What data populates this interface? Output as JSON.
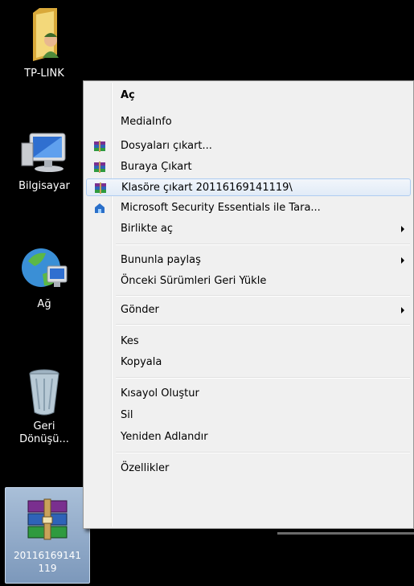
{
  "desktop": {
    "icons": [
      {
        "label": "TP-LINK"
      },
      {
        "label": "Bilgisayar"
      },
      {
        "label": "Ağ"
      },
      {
        "label": "Geri Dönüşü..."
      },
      {
        "label": "20116169141 119"
      }
    ]
  },
  "context_menu": {
    "items": [
      {
        "label": "Aç"
      },
      {
        "label": "MediaInfo"
      },
      {
        "label": "Dosyaları çıkart..."
      },
      {
        "label": "Buraya Çıkart"
      },
      {
        "label": "Klasöre çıkart 20116169141119\\"
      },
      {
        "label": "Microsoft Security Essentials ile Tara..."
      },
      {
        "label": "Birlikte aç"
      },
      {
        "label": "Bununla paylaş"
      },
      {
        "label": "Önceki Sürümleri Geri Yükle"
      },
      {
        "label": "Gönder"
      },
      {
        "label": "Kes"
      },
      {
        "label": "Kopyala"
      },
      {
        "label": "Kısayol Oluştur"
      },
      {
        "label": "Sil"
      },
      {
        "label": "Yeniden Adlandır"
      },
      {
        "label": "Özellikler"
      }
    ]
  },
  "colors": {
    "desktop_background": "#000000",
    "menu_background": "#f0f0f0",
    "hover_border": "#aeccf1",
    "selection_background": "#8aa6c8"
  }
}
